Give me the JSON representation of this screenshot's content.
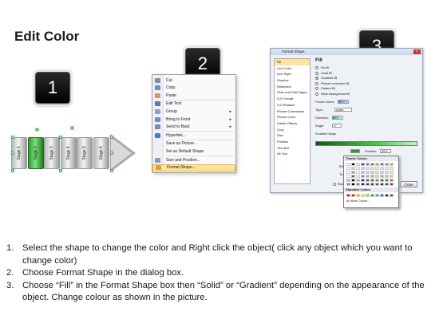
{
  "title": "Edit Color",
  "badges": [
    "1",
    "2",
    "3"
  ],
  "shape": {
    "segments": [
      "Stage 1",
      "Stage 2",
      "Stage 3",
      "Stage 4",
      "Stage 5",
      "Stage 6"
    ],
    "selected_index": 1,
    "selected_color": "#2d9a2d"
  },
  "context_menu": {
    "items": [
      {
        "label": "Cut",
        "icon": "scissors-icon",
        "arrow": ""
      },
      {
        "label": "Copy",
        "icon": "copy-icon",
        "arrow": ""
      },
      {
        "label": "Paste",
        "icon": "paste-icon",
        "arrow": ""
      },
      {
        "label": "Edit Text",
        "icon": "edit-text-icon",
        "arrow": ""
      },
      {
        "label": "Group",
        "icon": "group-icon",
        "arrow": "▸"
      },
      {
        "label": "Bring to Front",
        "icon": "bring-front-icon",
        "arrow": "▸"
      },
      {
        "label": "Send to Back",
        "icon": "send-back-icon",
        "arrow": "▸"
      },
      {
        "label": "Hyperlink...",
        "icon": "hyperlink-icon",
        "arrow": ""
      },
      {
        "label": "Save as Picture...",
        "icon": "",
        "arrow": ""
      },
      {
        "label": "Set as Default Shape",
        "icon": "",
        "arrow": ""
      },
      {
        "label": "Size and Position...",
        "icon": "size-icon",
        "arrow": ""
      },
      {
        "label": "Format Shape...",
        "icon": "format-shape-icon",
        "arrow": ""
      }
    ]
  },
  "dialog": {
    "title": "Format Shape",
    "categories": [
      "Fill",
      "Line Color",
      "Line Style",
      "Shadow",
      "Reflection",
      "Glow and Soft Edges",
      "3-D Format",
      "3-D Rotation",
      "Picture Corrections",
      "Picture Color",
      "Artistic Effects",
      "Crop",
      "Size",
      "Position",
      "Text Box",
      "Alt Text"
    ],
    "fill_heading": "Fill",
    "fill_options": [
      {
        "label": "No fill",
        "on": false
      },
      {
        "label": "Solid fill",
        "on": false
      },
      {
        "label": "Gradient fill",
        "on": true
      },
      {
        "label": "Picture or texture fill",
        "on": false
      },
      {
        "label": "Pattern fill",
        "on": false
      },
      {
        "label": "Slide background fill",
        "on": false
      }
    ],
    "preset_colors_label": "Preset colors:",
    "type_label": "Type:",
    "type_value": "Linear",
    "direction_label": "Direction:",
    "angle_label": "Angle:",
    "angle_value": "0°",
    "gradient_stops_label": "Gradient stops",
    "position_label": "Position:",
    "position_value": "80%",
    "brightness_label": "Brightness:",
    "transparency_label": "Transparency:",
    "rotate_label": "Rotate w",
    "close_label": "Close"
  },
  "palette": {
    "theme_label": "Theme Colors",
    "standard_label": "Standard Colors",
    "more_label": "More Colors...",
    "theme_row": [
      "#ffffff",
      "#000000",
      "#eeece1",
      "#1f497d",
      "#4f81bd",
      "#c0504d",
      "#9bbb59",
      "#8064a2",
      "#4bacc6",
      "#f79646"
    ],
    "standard_row": [
      "#c00000",
      "#ff0000",
      "#ffc000",
      "#ffff00",
      "#92d050",
      "#00b050",
      "#00b0f0",
      "#0070c0",
      "#002060",
      "#7030a0"
    ]
  },
  "steps": [
    {
      "n": "1.",
      "text": "Select the shape to change the color and Right click the object( click any object which you want to change color)"
    },
    {
      "n": "2.",
      "text": "Choose Format Shape in the dialog box."
    },
    {
      "n": "3.",
      "text": "Choose “Fill” in the Format Shape box then “Solid” or “Gradient” depending on the appearance of the object. Change colour as shown in the picture."
    }
  ]
}
